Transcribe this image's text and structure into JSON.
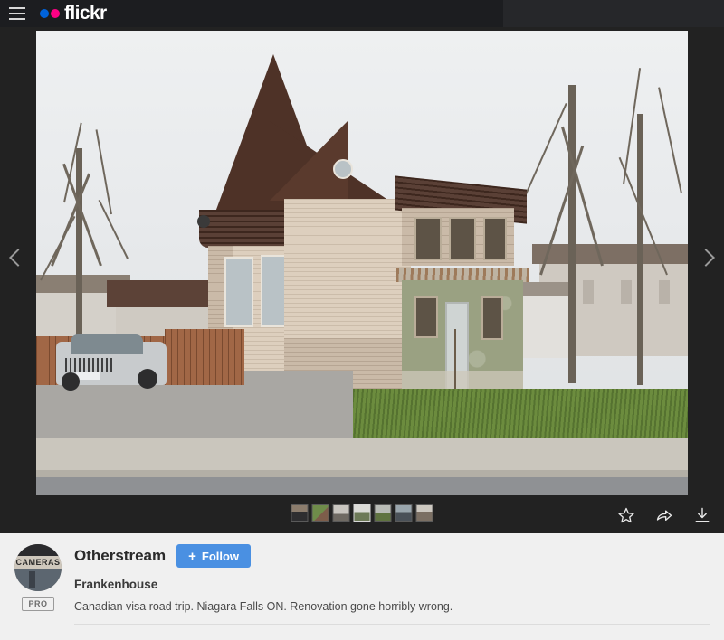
{
  "header": {
    "menu_icon": "hamburger-menu-icon",
    "logo_text": "flickr",
    "logo_dot_blue": "#0063DB",
    "logo_dot_pink": "#FF0084"
  },
  "viewer": {
    "prev_label": "Previous photo",
    "next_label": "Next photo",
    "actions": [
      {
        "name": "favorite",
        "icon": "star-icon",
        "label": "Favorite"
      },
      {
        "name": "share",
        "icon": "share-arrow-icon",
        "label": "Share"
      },
      {
        "name": "download",
        "icon": "download-icon",
        "label": "Download"
      }
    ],
    "thumbnails": [
      {
        "label": "thumbnail-1",
        "active": false
      },
      {
        "label": "thumbnail-2",
        "active": false
      },
      {
        "label": "thumbnail-3",
        "active": false
      },
      {
        "label": "thumbnail-4",
        "active": true
      },
      {
        "label": "thumbnail-5",
        "active": false
      },
      {
        "label": "thumbnail-6",
        "active": false
      },
      {
        "label": "thumbnail-7",
        "active": false
      }
    ]
  },
  "photo": {
    "alt": "Two-story beige Victorian house with brown shingled turret roof joined to a deteriorating green stucco addition; silver SUV parked on driveway beside a wooden fence, bare trees and overcast sky"
  },
  "info": {
    "owner": "Otherstream",
    "follow_label": "Follow",
    "follow_plus": "+",
    "pro_badge": "PRO",
    "avatar_text": "CAMERAS",
    "title": "Frankenhouse",
    "description": "Canadian visa road trip. Niagara Falls ON. Renovation gone horribly wrong.",
    "accent_color": "#4a90e2"
  }
}
